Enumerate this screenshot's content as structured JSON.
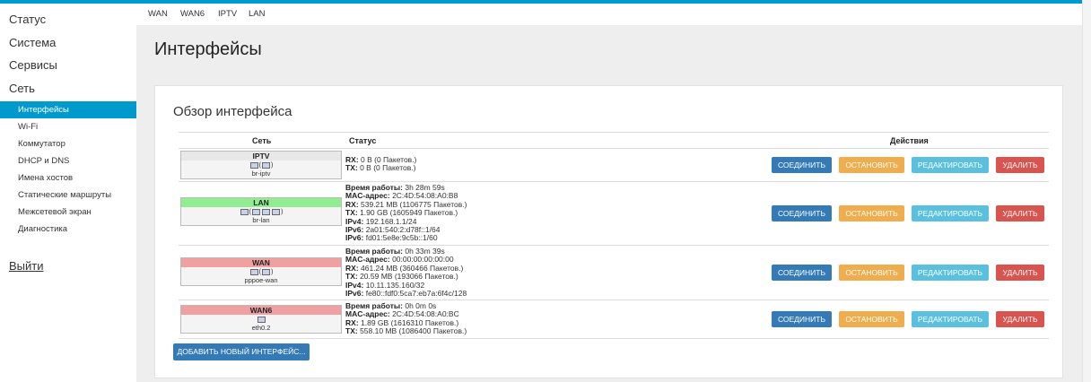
{
  "sidebar": {
    "top_items": [
      "Статус",
      "Система",
      "Сервисы",
      "Сеть"
    ],
    "sub_items": [
      "Интерфейсы",
      "Wi-Fi",
      "Коммутатор",
      "DHCP и DNS",
      "Имена хостов",
      "Статические маршруты",
      "Межсетевой экран",
      "Диагностика"
    ],
    "active_sub_index": 0,
    "logout": "Выйти"
  },
  "tabs": [
    "WAN",
    "WAN6",
    "IPTV",
    "LAN"
  ],
  "page": {
    "title": "Интерфейсы",
    "section_title": "Обзор интерфейса"
  },
  "table": {
    "columns": [
      "Сеть",
      "Статус",
      "Действия"
    ],
    "actions": {
      "connect": "СОЕДИНИТЬ",
      "stop": "ОСТАНОВИТЬ",
      "edit": "РЕДАКТИРОВАТЬ",
      "delete": "УДАЛИТЬ"
    },
    "rows": [
      {
        "name": "IPTV",
        "icons": "(",
        "icons_close": ")",
        "device": "br-iptv",
        "header_color": "#e8e8e8",
        "status": [
          {
            "label": "RX",
            "value": "0 B (0 Пакетов.)"
          },
          {
            "label": "TX",
            "value": "0 B (0 Пакетов.)"
          }
        ]
      },
      {
        "name": "LAN",
        "icons": "(",
        "icons_close": ")",
        "device": "br-lan",
        "header_color": "#90ee90",
        "status": [
          {
            "label": "Время работы",
            "value": "3h 28m 59s"
          },
          {
            "label": "MAC-адрес",
            "value": "2C:4D:54:08:A0:B8"
          },
          {
            "label": "RX",
            "value": "539.21 MB (1106775 Пакетов.)"
          },
          {
            "label": "TX",
            "value": "1.90 GB (1605949 Пакетов.)"
          },
          {
            "label": "IPv4",
            "value": "192.168.1.1/24"
          },
          {
            "label": "IPv6",
            "value": "2a01:540:2:d78f::1/64"
          },
          {
            "label": "IPv6",
            "value": "fd01:5e8e:9c5b::1/60"
          }
        ]
      },
      {
        "name": "WAN",
        "icons": "(",
        "icons_close": ")",
        "device": "pppoe-wan",
        "header_color": "#f0a0a0",
        "status": [
          {
            "label": "Время работы",
            "value": "0h 33m 39s"
          },
          {
            "label": "MAC-адрес",
            "value": "00:00:00:00:00:00"
          },
          {
            "label": "RX",
            "value": "461.24 MB (360466 Пакетов.)"
          },
          {
            "label": "TX",
            "value": "20.59 MB (193066 Пакетов.)"
          },
          {
            "label": "IPv4",
            "value": "10.11.135.160/32"
          },
          {
            "label": "IPv6",
            "value": "fe80::fdf0:5ca7:eb7a:6f4c/128"
          }
        ]
      },
      {
        "name": "WAN6",
        "icons": "",
        "icons_close": "",
        "device": "eth0.2",
        "header_color": "#f0a0a0",
        "status": [
          {
            "label": "Время работы",
            "value": "0h 0m 0s"
          },
          {
            "label": "MAC-адрес",
            "value": "2C:4D:54:08:A0:BC"
          },
          {
            "label": "RX",
            "value": "1.89 GB (1616310 Пакетов.)"
          },
          {
            "label": "TX",
            "value": "558.10 MB (1086400 Пакетов.)"
          }
        ]
      }
    ]
  },
  "add_button": "ДОБАВИТЬ НОВЫЙ ИНТЕРФЕЙС...",
  "colors": {
    "accent": "#0099cc",
    "btn_connect": "#337ab7",
    "btn_stop": "#f0ad4e",
    "btn_edit": "#5bc0de",
    "btn_delete": "#d9534f"
  }
}
